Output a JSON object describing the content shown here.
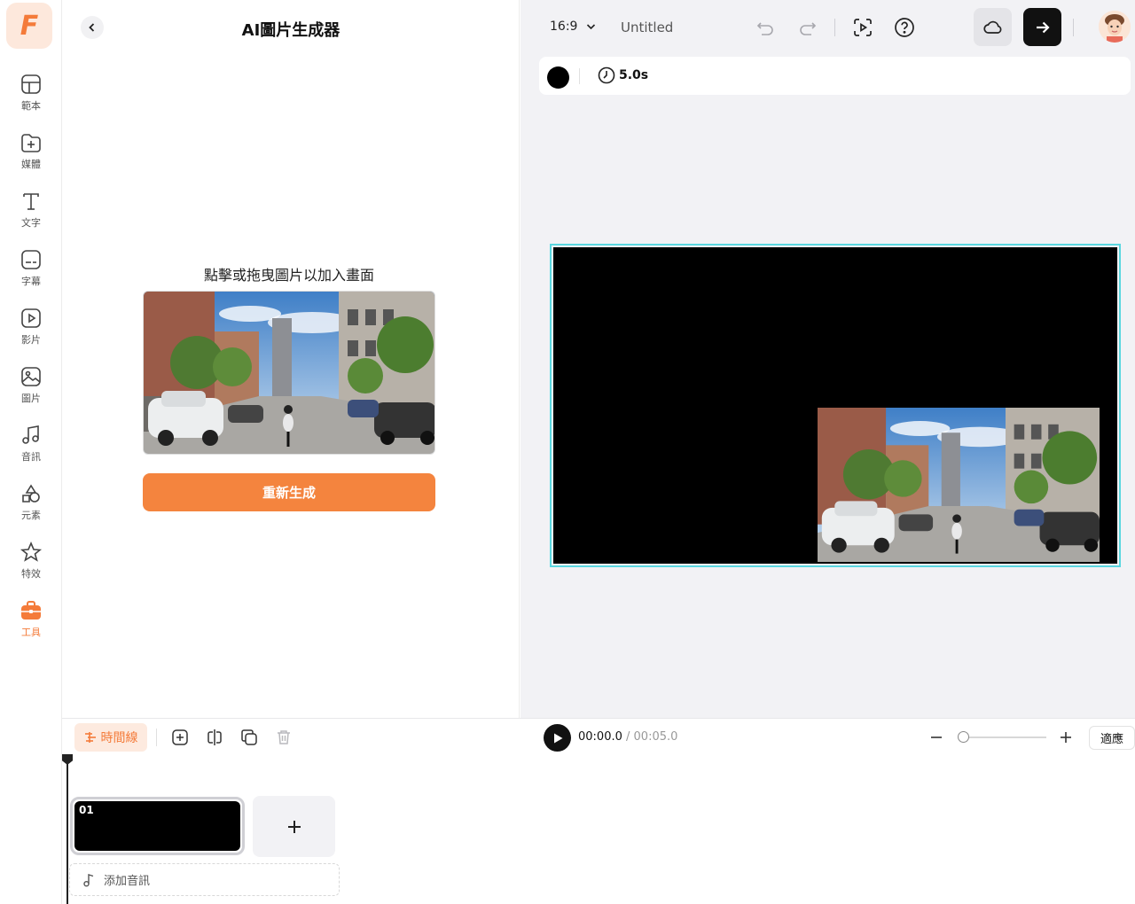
{
  "app": {
    "logo_letter": "F",
    "accent_color": "#f47b3a"
  },
  "sidebar": {
    "items": [
      {
        "label": "範本",
        "icon": "template-icon"
      },
      {
        "label": "媒體",
        "icon": "media-folder-icon"
      },
      {
        "label": "文字",
        "icon": "text-icon"
      },
      {
        "label": "字幕",
        "icon": "subtitle-icon"
      },
      {
        "label": "影片",
        "icon": "video-icon"
      },
      {
        "label": "圖片",
        "icon": "image-icon"
      },
      {
        "label": "音訊",
        "icon": "music-icon"
      },
      {
        "label": "元素",
        "icon": "elements-icon"
      },
      {
        "label": "特效",
        "icon": "effects-icon"
      },
      {
        "label": "工具",
        "icon": "toolbox-icon",
        "active": true
      }
    ]
  },
  "panel": {
    "title": "AI圖片生成器",
    "hint": "點擊或拖曳圖片以加入畫面",
    "regenerate_label": "重新生成"
  },
  "topbar": {
    "aspect_ratio": "16:9",
    "project_name": "Untitled"
  },
  "props": {
    "background_color": "#000000",
    "duration": "5.0s"
  },
  "timeline": {
    "tab_label": "時間線",
    "current_time": "00:00.0",
    "separator": " / ",
    "total_time": "00:05.0",
    "fit_label": "適應",
    "zoom_level": 0.05,
    "clips": [
      {
        "number": "01"
      }
    ],
    "add_audio_label": "添加音訊"
  }
}
